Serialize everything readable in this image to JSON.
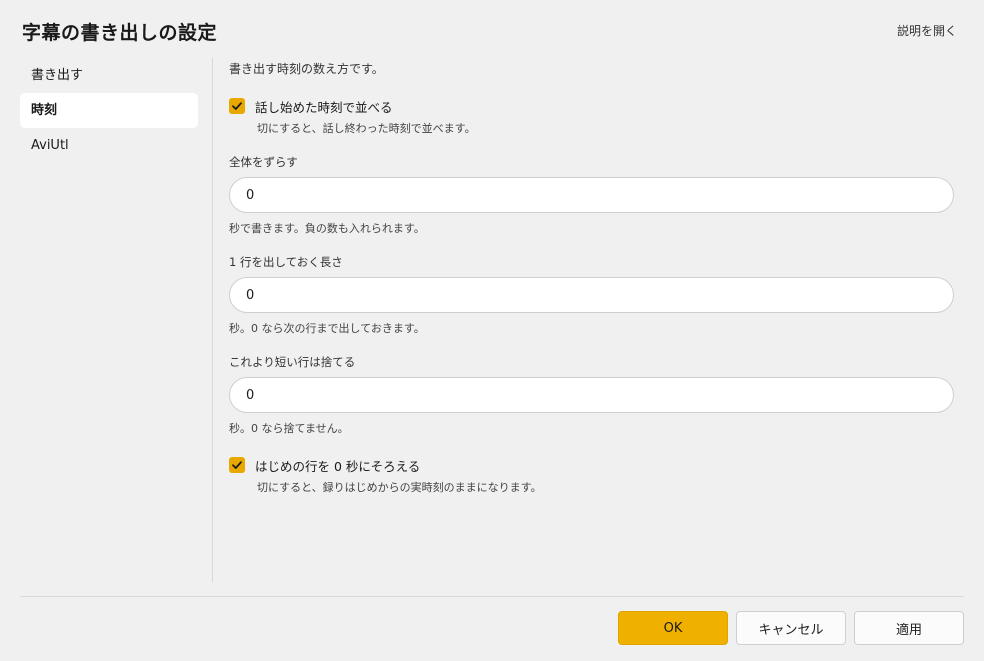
{
  "dialog": {
    "title": "字幕の書き出しの設定",
    "help_link": "説明を開く"
  },
  "sidebar": {
    "items": [
      {
        "label": "書き出す",
        "active": false
      },
      {
        "label": "時刻",
        "active": true
      },
      {
        "label": "AviUtl",
        "active": false
      }
    ]
  },
  "content": {
    "description": "書き出す時刻の数え方です。",
    "sort_by_start": {
      "label": "話し始めた時刻で並べる",
      "checked": true,
      "note": "切にすると、話し終わった時刻で並べます。"
    },
    "shift_all": {
      "label": "全体をずらす",
      "value": "0",
      "note": "秒で書きます。負の数も入れられます。"
    },
    "line_duration": {
      "label": "1 行を出しておく長さ",
      "value": "0",
      "note": "秒。0 なら次の行まで出しておきます。"
    },
    "discard_short": {
      "label": "これより短い行は捨てる",
      "value": "0",
      "note": "秒。0 なら捨てません。"
    },
    "align_first_zero": {
      "label": "はじめの行を 0 秒にそろえる",
      "checked": true,
      "note": "切にすると、録りはじめからの実時刻のままになります。"
    }
  },
  "footer": {
    "ok_label": "OK",
    "cancel_label": "キャンセル",
    "apply_label": "適用"
  },
  "colors": {
    "accent": "#f0b000",
    "checkbox": "#e8a800",
    "background": "#f0f0f0"
  },
  "icons": {
    "checkbox_check": "checkmark-icon"
  }
}
